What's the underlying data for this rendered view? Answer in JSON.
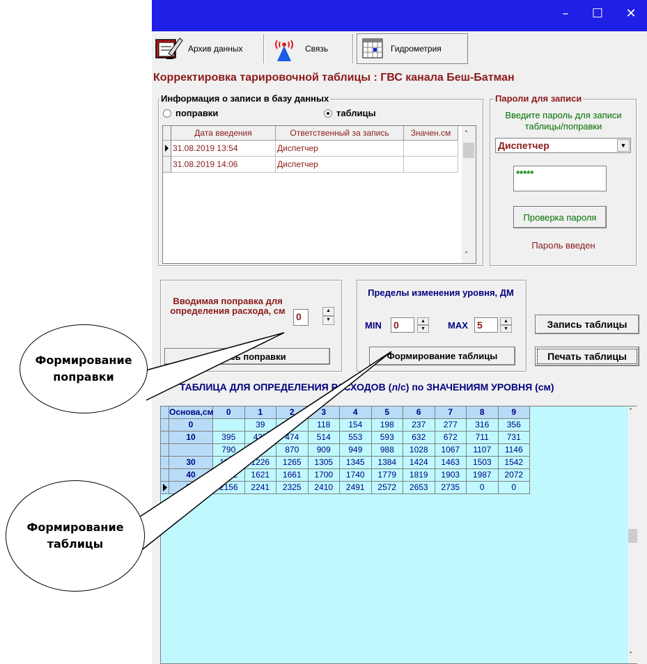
{
  "window": {
    "controls": {
      "minimize": "–",
      "maximize": "☐",
      "close": "✕"
    }
  },
  "toolbar": {
    "items": [
      {
        "label": "Архив данных",
        "icon": "archive-icon"
      },
      {
        "label": "Связь",
        "icon": "antenna-icon"
      },
      {
        "label": "Гидрометрия",
        "icon": "calendar-grid-icon"
      }
    ]
  },
  "heading": "Корректировка тарировочной таблицы : ГВС канала Беш-Батман",
  "info_group": {
    "title": "Информация о записи в базу данных",
    "radio_corrections": "поправки",
    "radio_tables": "таблицы",
    "selected": "таблицы",
    "columns": [
      "Дата введения",
      "Ответственный за запись",
      "Значен.см"
    ],
    "rows": [
      {
        "date": "31.08.2019 13:54",
        "responsible": "Диспетчер",
        "value": ""
      },
      {
        "date": "31.08.2019 14:06",
        "responsible": "Диспетчер",
        "value": ""
      }
    ]
  },
  "password_group": {
    "title": "Пароли для записи",
    "prompt": "Введите пароль для записи таблицы/поправки",
    "user": "Диспетчер",
    "password_value": "*****",
    "check_button": "Проверка пароля",
    "status": "Пароль введен"
  },
  "correction_group": {
    "label": "Вводимая поправка для определения расхода, см",
    "value": "0",
    "button": "Запись поправки"
  },
  "limits_group": {
    "title": "Пределы изменения уровня, ДМ",
    "min_label": "MIN",
    "min_value": "0",
    "max_label": "MAX",
    "max_value": "5",
    "button": "Формирование таблицы"
  },
  "buttons": {
    "write_table": "Запись таблицы",
    "print_table": "Печать таблицы"
  },
  "table": {
    "title": "ТАБЛИЦА ДЛЯ ОПРЕДЕЛЕНИЯ РАСХОДОВ (л/с) по ЗНАЧЕНИЯМ УРОВНЯ (см)",
    "header": [
      "Основа,см",
      "0",
      "1",
      "2",
      "3",
      "4",
      "5",
      "6",
      "7",
      "8",
      "9"
    ],
    "rows": [
      [
        "0",
        "",
        "39",
        "79",
        "118",
        "154",
        "198",
        "237",
        "277",
        "316",
        "356"
      ],
      [
        "10",
        "395",
        "435",
        "474",
        "514",
        "553",
        "593",
        "632",
        "672",
        "711",
        "731"
      ],
      [
        "",
        "790",
        "830",
        "870",
        "909",
        "949",
        "988",
        "1028",
        "1067",
        "1107",
        "1146"
      ],
      [
        "30",
        "1186",
        "1226",
        "1265",
        "1305",
        "1345",
        "1384",
        "1424",
        "1463",
        "1503",
        "1542"
      ],
      [
        "40",
        "1582",
        "1621",
        "1661",
        "1700",
        "1740",
        "1779",
        "1819",
        "1903",
        "1987",
        "2072"
      ],
      [
        "50",
        "2156",
        "2241",
        "2325",
        "2410",
        "2491",
        "2572",
        "2653",
        "2735",
        "0",
        "0"
      ]
    ]
  },
  "callouts": {
    "correction": "Формирование поправки",
    "table": "Формирование таблицы"
  },
  "colors": {
    "titlebar": "#1f1fe6",
    "heading": "#8b1a1a",
    "table_bg": "#bff9ff",
    "table_header": "#b8dcf8",
    "table_text": "#000080"
  }
}
